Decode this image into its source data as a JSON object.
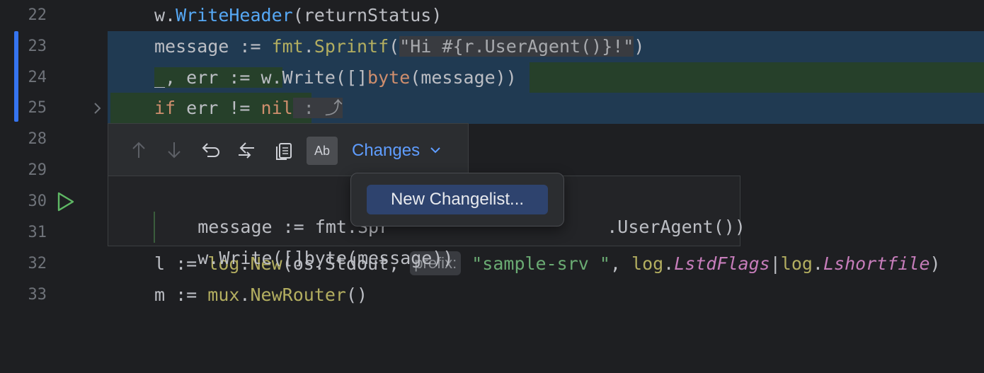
{
  "gutter": {
    "line_numbers": [
      "22",
      "23",
      "24",
      "25",
      "28",
      "29",
      "30",
      "31",
      "32",
      "33"
    ],
    "fold_icon": "chevron-right-icon",
    "run_icon": "run-triangle-icon"
  },
  "code": {
    "l22": {
      "recv": "w.",
      "fn": "WriteHeader",
      "rest": "(returnStatus)"
    },
    "l23": {
      "a": "message := ",
      "pkg": "fmt",
      "dot": ".",
      "fn": "Sprintf",
      "open": "(",
      "str": "\"Hi #{r.UserAgent()}!\"",
      "close": ")"
    },
    "l24": {
      "a": "_, err := w.",
      "fn": "Write",
      "b": "([]",
      "kw": "byte",
      "c": "(message))"
    },
    "l25": {
      "kw": "if",
      "a": " err != ",
      "kw2": "nil",
      "tail": " : ⤴"
    },
    "l32": {
      "a": "l := ",
      "pkg": "log",
      "dot": ".",
      "fn": "New",
      "b": "(os.Stdout, ",
      "hint": "prefix:",
      "str": " \"sample-srv \"",
      "c": ", ",
      "pkg2": "log",
      "d": ".",
      "i1": "LstdFlags",
      "e": "|",
      "pkg3": "log",
      "f": ".",
      "i2": "Lshortfile",
      "g": ")"
    },
    "l33": {
      "a": "m := ",
      "pkg": "mux",
      "dot": ".",
      "fn": "NewRouter",
      "b": "()"
    }
  },
  "toolbar": {
    "icons": [
      "up-arrow-icon",
      "down-arrow-icon",
      "undo-icon",
      "merge-icon",
      "copy-icon"
    ],
    "ab_label": "Ab",
    "changes_label": "Changes",
    "changes_chevron": "⌄"
  },
  "diff": {
    "l1_left": "message := fmt.Spr",
    "l1_right": ".UserAgent())",
    "l2": "w.Write([]byte(message))"
  },
  "popup": {
    "item": "New Changelist..."
  },
  "colors": {
    "accent": "#3574f0",
    "link": "#5f9dff",
    "added_bg": "#26402a",
    "modified_bg": "#203a52"
  }
}
